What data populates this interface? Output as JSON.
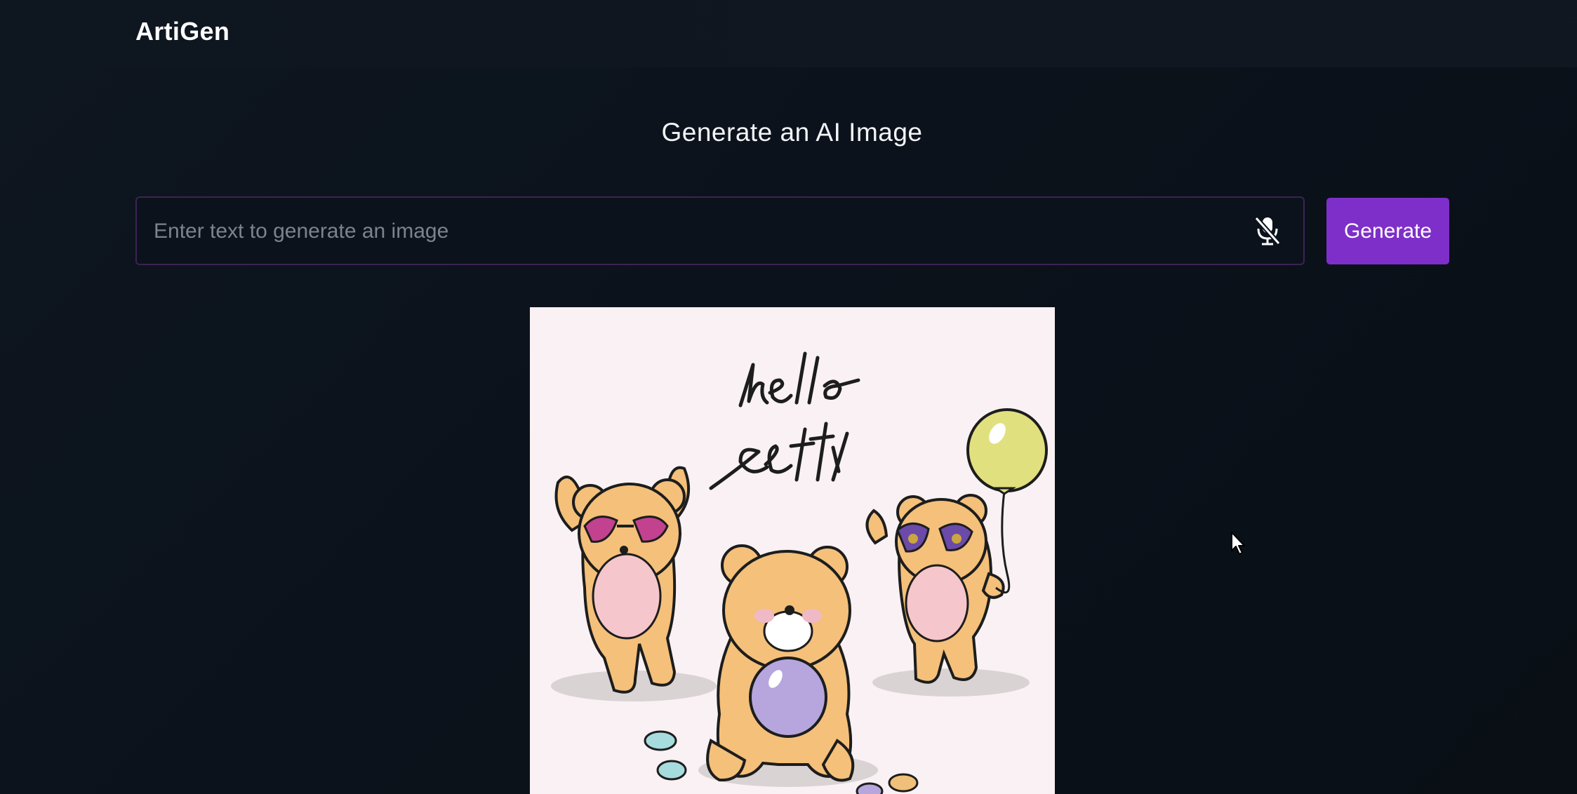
{
  "app": {
    "logo": "ArtiGen"
  },
  "main": {
    "heading": "Generate an AI Image",
    "prompt": {
      "placeholder": "Enter text to generate an image",
      "value": ""
    },
    "mic_icon": "microphone-off-icon",
    "generate_label": "Generate",
    "result_image": {
      "handwritten_text": "hello setty",
      "description_icon": "teddy-bears-illustration"
    }
  },
  "colors": {
    "background": "#0b1119",
    "accent": "#7e2fc9",
    "input_border": "#3a2452",
    "image_bg": "#f9f1f3"
  }
}
